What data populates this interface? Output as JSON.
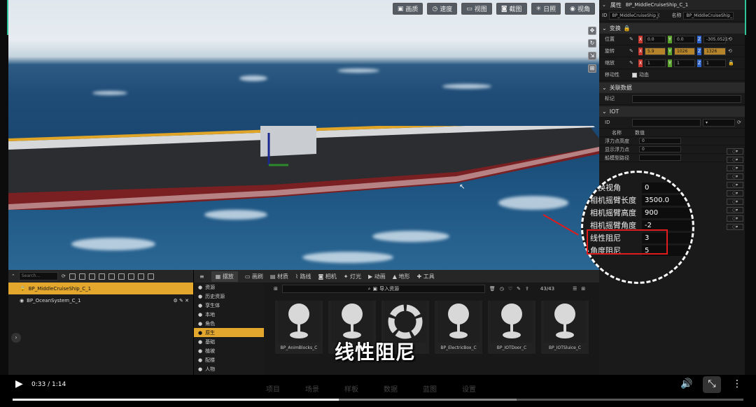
{
  "viewport": {
    "toolbar": [
      "画质",
      "速度",
      "视图",
      "截图",
      "日照",
      "视角"
    ]
  },
  "properties": {
    "header": {
      "title": "属性",
      "name": "BP_MiddleCruiseShip_C_1"
    },
    "id_row": {
      "id_label": "ID",
      "id_value": "BP_MiddleCruiseShip_(",
      "name_label": "名称",
      "name_value": "BP_MiddleCruiseShip_"
    },
    "transform": {
      "title": "变换",
      "location": {
        "label": "位置",
        "x": "0.0",
        "y": "0.0",
        "z": "-305.0521"
      },
      "rotation": {
        "label": "旋转",
        "x": "5.9",
        "y": "1026",
        "z": "1326"
      },
      "scale": {
        "label": "缩放",
        "x": "1",
        "y": "1",
        "z": "1"
      },
      "mobility": {
        "label": "移动性",
        "value": "动态"
      }
    },
    "related": {
      "title": "关联数据",
      "tag_label": "标记"
    },
    "iot": {
      "title": "IOT",
      "id_label": "ID",
      "col_name": "名称",
      "col_value": "数值",
      "rows": [
        {
          "name": "浮力点高度",
          "value": "0"
        },
        {
          "name": "显示浮力点",
          "value": "0"
        },
        {
          "name": "船模型路径",
          "value": ""
        }
      ]
    }
  },
  "magnifier": {
    "rows": [
      {
        "label": "切换视角",
        "value": "0"
      },
      {
        "label": "相机摇臂长度",
        "value": "3500.0"
      },
      {
        "label": "相机摇臂高度",
        "value": "900"
      },
      {
        "label": "相机摇臂角度",
        "value": "-2"
      },
      {
        "label": "线性阻尼",
        "value": "3"
      },
      {
        "label": "角度阻尼",
        "value": "5"
      }
    ]
  },
  "outliner": {
    "search_placeholder": "Search...",
    "items": [
      {
        "label": "BP_MiddleCruiseShip_C_1",
        "selected": true
      },
      {
        "label": "BP_OceanSystem_C_1",
        "selected": false
      }
    ]
  },
  "content_browser": {
    "tabs": [
      "摆放",
      "画刷",
      "材质",
      "路线",
      "相机",
      "灯光",
      "动画",
      "地形",
      "工具"
    ],
    "tree": [
      {
        "label": "资源",
        "selected": false
      },
      {
        "label": "历史资源",
        "selected": false
      },
      {
        "label": "孪生体",
        "selected": false
      },
      {
        "label": "本地",
        "selected": false
      },
      {
        "label": "角色",
        "selected": false
      },
      {
        "label": "原生",
        "selected": true
      },
      {
        "label": "基础",
        "selected": false
      },
      {
        "label": "植被",
        "selected": false
      },
      {
        "label": "配楼",
        "selected": false
      },
      {
        "label": "人物",
        "selected": false
      }
    ],
    "import_label": "导入资源",
    "count": "43/43",
    "assets": [
      {
        "name": "BP_AnimBlocks_C",
        "icon": "pin-icon"
      },
      {
        "name": "BP_...",
        "icon": "pin-icon"
      },
      {
        "name": "BP_...",
        "icon": "ring-icon"
      },
      {
        "name": "BP_ElectricBox_C",
        "icon": "pin-icon"
      },
      {
        "name": "BP_IOTDoor_C",
        "icon": "pin-icon"
      },
      {
        "name": "BP_IOTSluice_C",
        "icon": "pin-icon"
      }
    ]
  },
  "subtitle": "线性阻尼",
  "player": {
    "time": "0:33 / 1:14",
    "progress": 0.446,
    "buffered": 0.69,
    "faint_nav": [
      "项目",
      "场景",
      "样板",
      "数据",
      "蓝图",
      "设置"
    ]
  }
}
